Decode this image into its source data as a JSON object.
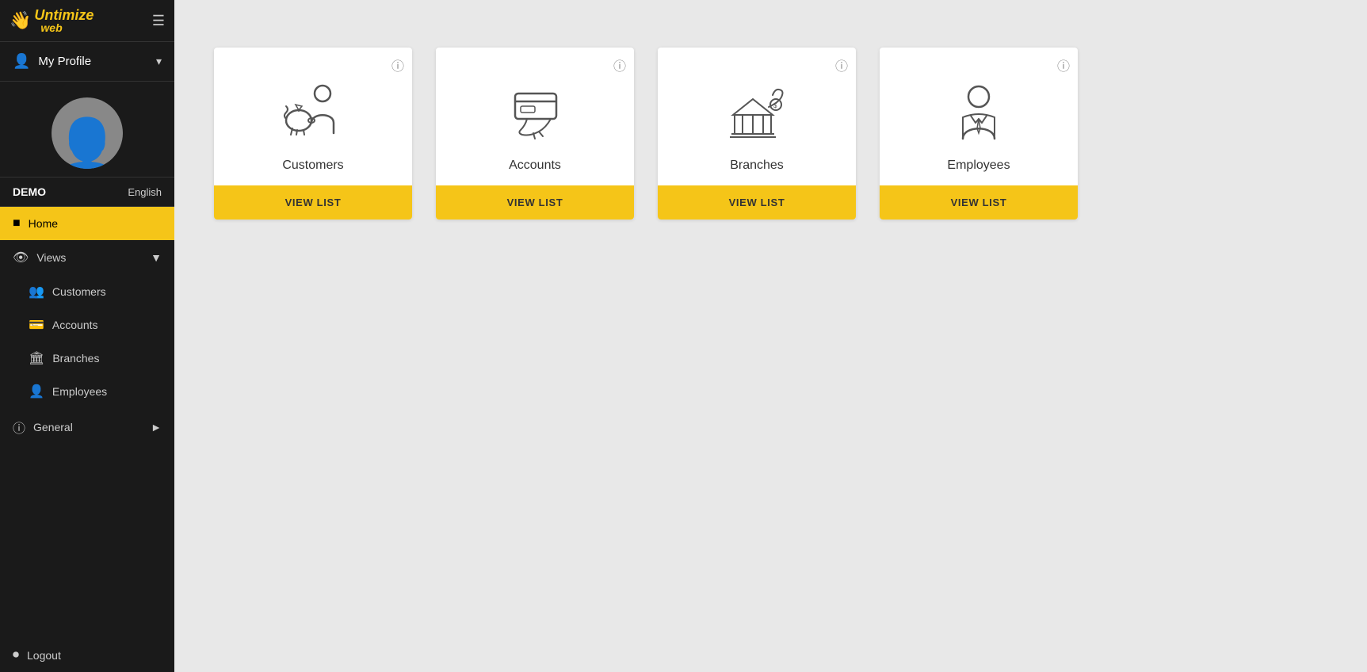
{
  "sidebar": {
    "logo": {
      "line1": "ntimize",
      "line2": "web"
    },
    "profile": {
      "label": "My Profile",
      "chevron": "▾"
    },
    "user": {
      "name": "DEMO",
      "language": "English"
    },
    "nav": {
      "home_label": "Home",
      "views_label": "Views",
      "subitems": [
        {
          "label": "Customers",
          "icon": "👥"
        },
        {
          "label": "Accounts",
          "icon": "💳"
        },
        {
          "label": "Branches",
          "icon": "🏛"
        },
        {
          "label": "Employees",
          "icon": "👤"
        }
      ],
      "general_label": "General",
      "logout_label": "Logout"
    }
  },
  "cards": [
    {
      "id": "customers",
      "label": "Customers",
      "btn_label": "VIEW LIST"
    },
    {
      "id": "accounts",
      "label": "Accounts",
      "btn_label": "VIEW LIST"
    },
    {
      "id": "branches",
      "label": "Branches",
      "btn_label": "VIEW LIST"
    },
    {
      "id": "employees",
      "label": "Employees",
      "btn_label": "VIEW LIST"
    }
  ]
}
